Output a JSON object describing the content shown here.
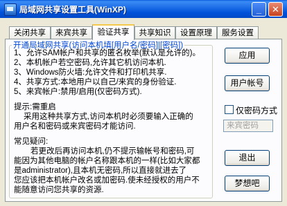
{
  "window": {
    "title": "局域网共享设置工具(WinXP)"
  },
  "tabs": [
    {
      "label": "关闭共享"
    },
    {
      "label": "来宾共享"
    },
    {
      "label": "验证共享"
    },
    {
      "label": "共享知识"
    },
    {
      "label": "设置原理"
    },
    {
      "label": "服务设置"
    }
  ],
  "group": {
    "legend": "开通局域网共享(访问本机填[用户名/密码]|[密码])",
    "lines": [
      "1、允许SAM帐户和共享的匿名枚举(默认是允许的)。",
      "2、本机帐户若空密码,允许其它机访问本机.",
      "3、Windows防火墙:允许文件和打印机共享.",
      "4、共享方式:本地用户以自己/来宾的身份验证.",
      "5、来宾帐户:禁用/启用(仅密码方式).",
      "提示:需重启",
      "采用这种共享方式,访问本机时必须要输入正确的",
      "用户名和密码或来宾密码才能访问.",
      "常见疑问:",
      "若更改后再访问本机,仍不提示输帐号和密码,可",
      "能因为其他电脑的帐户名称跟本机的一样(比如大家都",
      "是administrator),且本机无密码,所以直接就进去了",
      "您应该把本机帐户改名或加密码.使未经授权的用户不",
      "能随意访问您共享的资源."
    ]
  },
  "buttons": {
    "apply": "应用",
    "user_account": "用户帐号",
    "exit": "退出",
    "idea": "梦想吧"
  },
  "password_only": {
    "label": "仅密码方式",
    "checked": false
  },
  "guest_password": {
    "placeholder": "来宾密码"
  }
}
